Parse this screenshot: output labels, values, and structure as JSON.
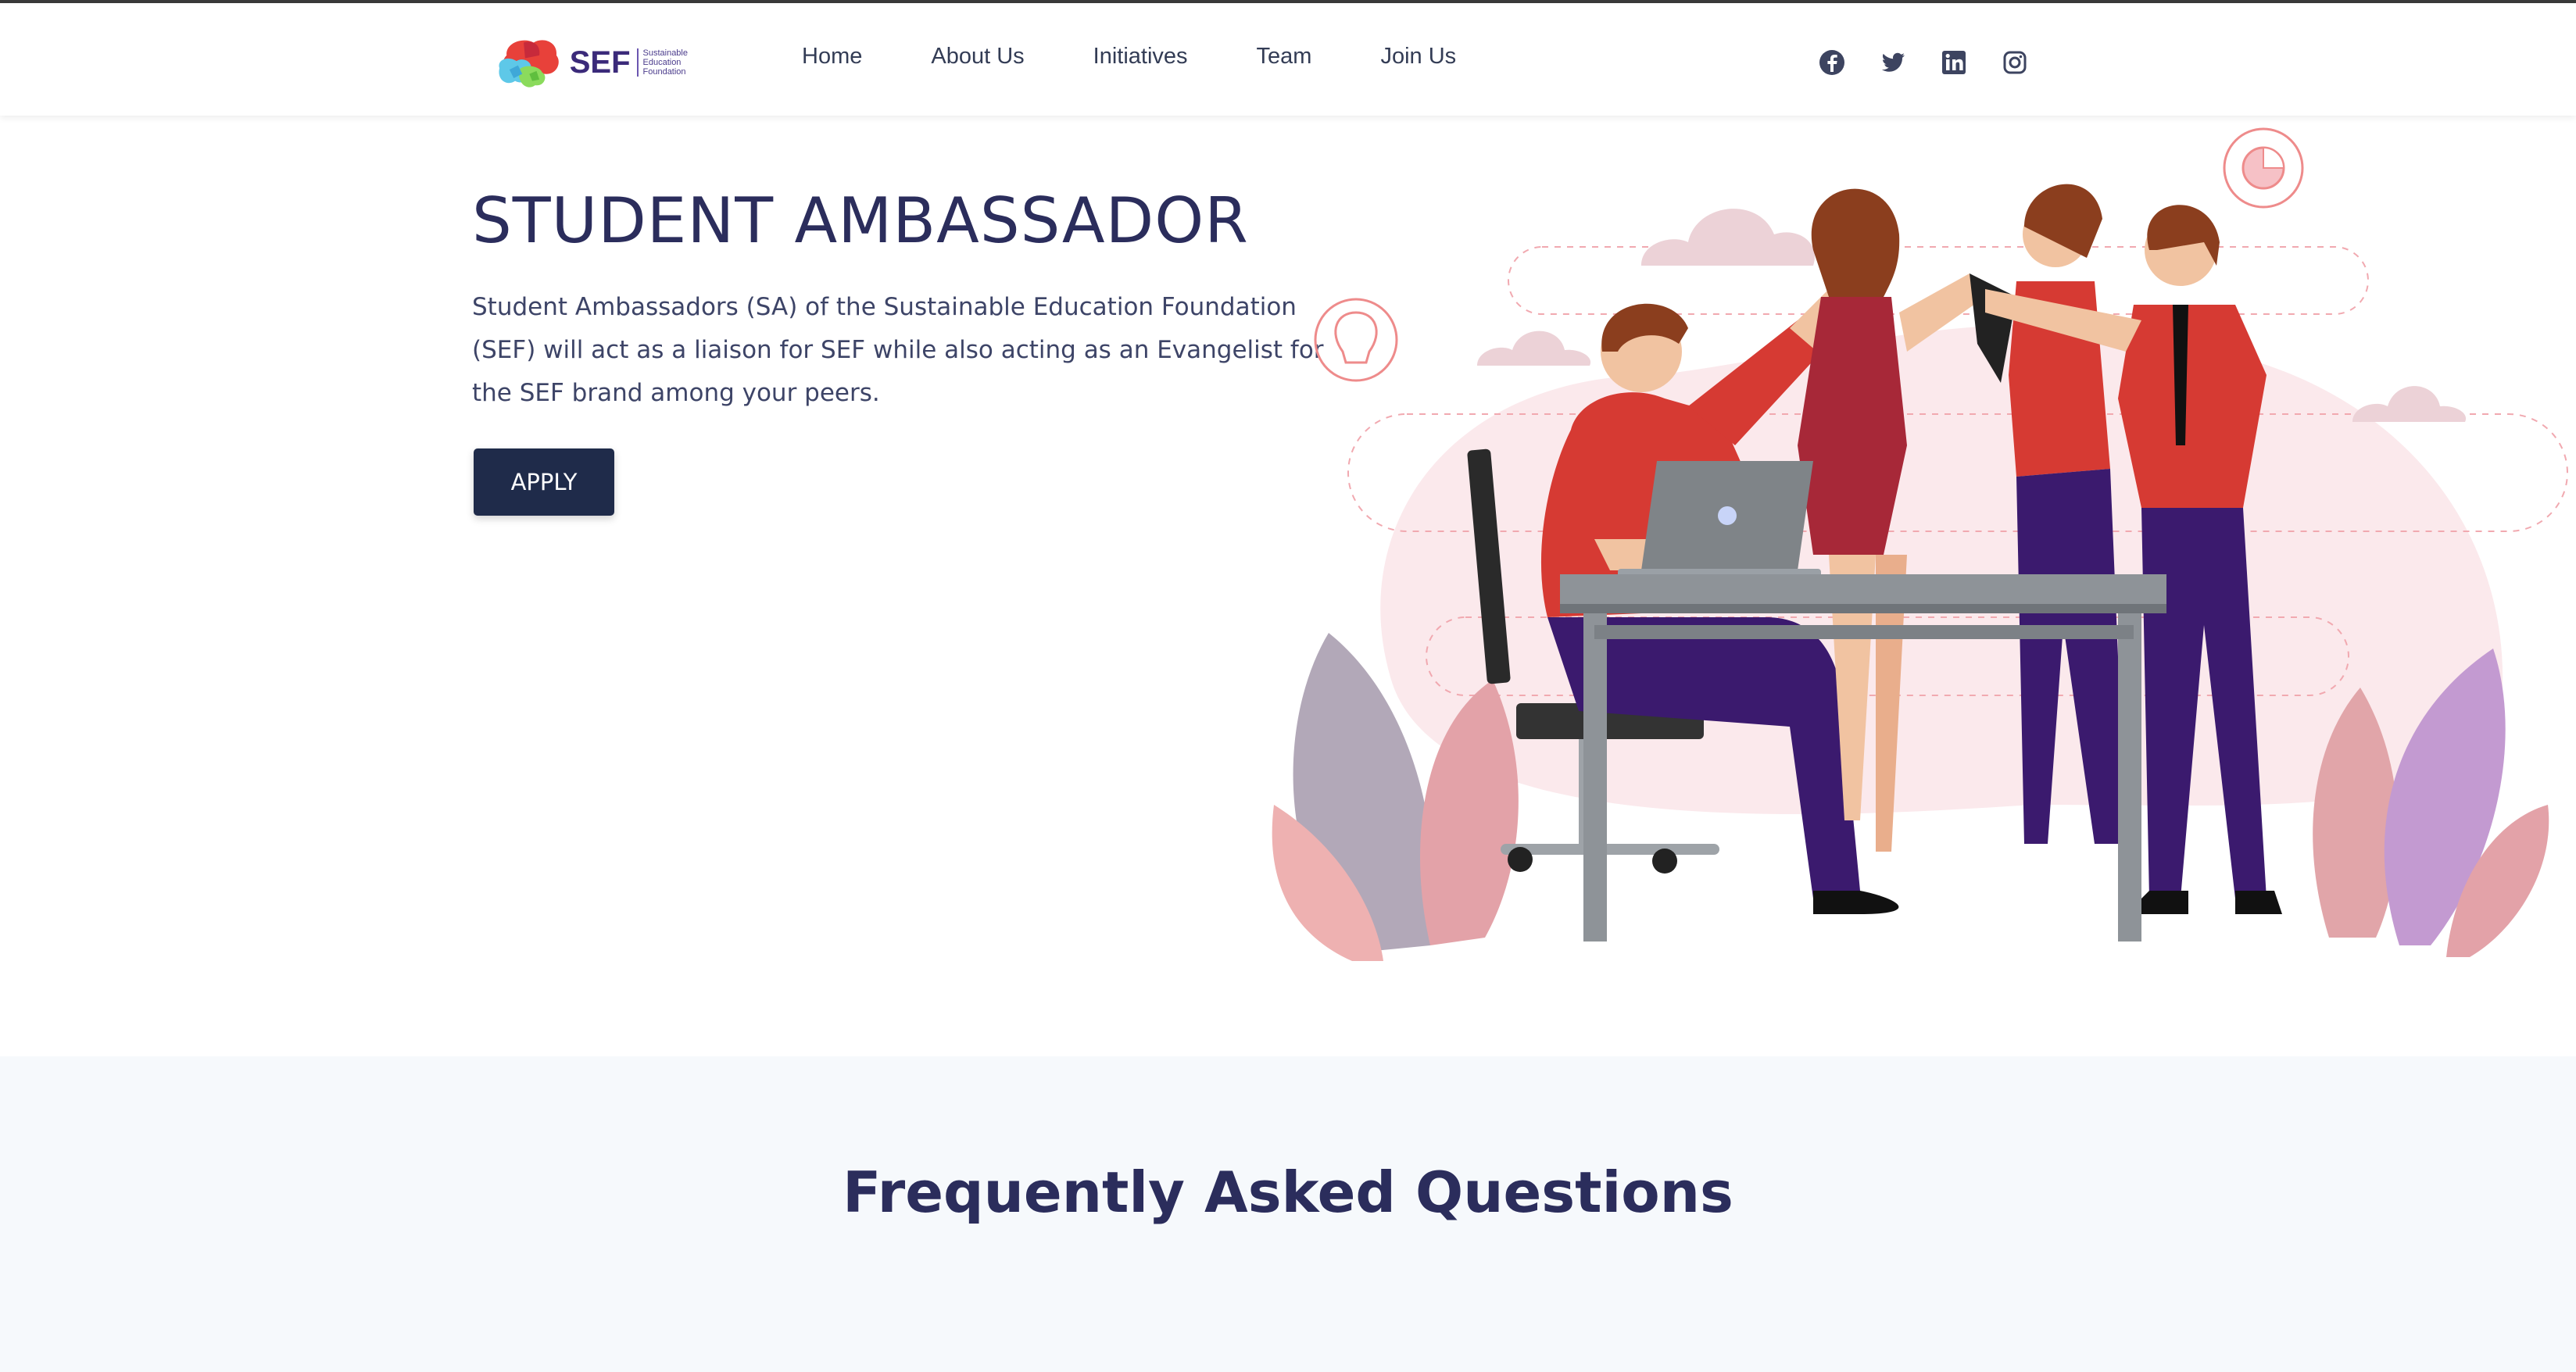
{
  "brand": {
    "name": "SEF",
    "sub_line1": "Sustainable",
    "sub_line2": "Education",
    "sub_line3": "Foundation"
  },
  "nav": {
    "items": [
      {
        "label": "Home"
      },
      {
        "label": "About Us"
      },
      {
        "label": "Initiatives"
      },
      {
        "label": "Team"
      },
      {
        "label": "Join Us"
      }
    ]
  },
  "social": {
    "icons": [
      "facebook-icon",
      "twitter-icon",
      "linkedin-icon",
      "instagram-icon"
    ]
  },
  "hero": {
    "title_part1": "STUDENT ",
    "title_part2": "AMBASSADOR",
    "description": "Student Ambassadors (SA) of the Sustainable Education Foundation (SEF) will act as a liaison for SEF while also acting as an Evangelist for the SEF brand among your peers.",
    "apply_label": "APPLY"
  },
  "faq": {
    "title": "Frequently Asked Questions"
  },
  "colors": {
    "primary_dark": "#1f2b4a",
    "heading": "#2b2d5c",
    "accent_red": "#d63a33",
    "accent_purple": "#3b1a6e",
    "faq_bg": "#f6f9fc"
  }
}
